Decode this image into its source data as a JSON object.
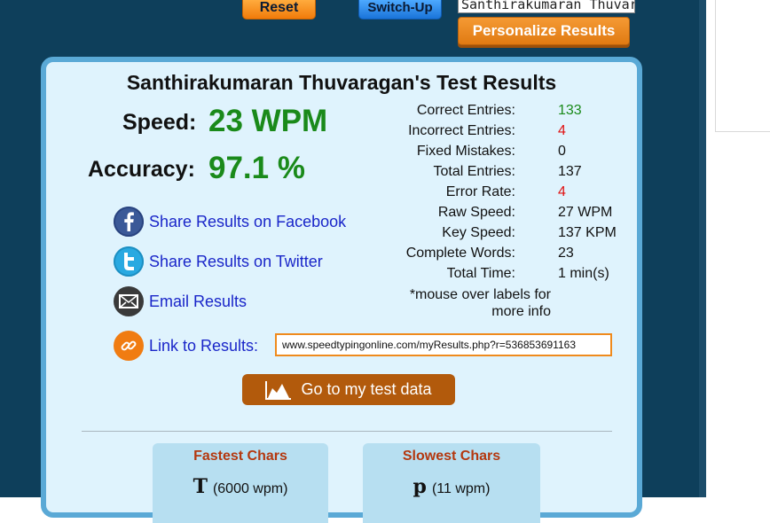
{
  "header": {
    "reset_label": "Reset",
    "switch_up_label": "Switch-Up",
    "name_input_value": "Santhirakumaran Thuvaragan",
    "personalize_label": "Personalize Results"
  },
  "results": {
    "title": "Santhirakumaran Thuvaragan's Test Results",
    "speed_label": "Speed:",
    "speed_value": "23 WPM",
    "accuracy_label": "Accuracy:",
    "accuracy_value": "97.1 %"
  },
  "share": {
    "facebook_label": "Share Results on Facebook",
    "twitter_label": "Share Results on Twitter",
    "email_label": "Email Results",
    "link_label": "Link to Results:",
    "link_value": "www.speedtypingonline.com/myResults.php?r=536853691163"
  },
  "stats": [
    {
      "label": "Correct Entries:",
      "value": "133",
      "color": "#1a8a1a"
    },
    {
      "label": "Incorrect Entries:",
      "value": "4",
      "color": "#e01010"
    },
    {
      "label": "Fixed Mistakes:",
      "value": "0",
      "color": "#111111"
    },
    {
      "label": "Total Entries:",
      "value": "137",
      "color": "#111111"
    },
    {
      "label": "Error Rate:",
      "value": "4",
      "color": "#e01010"
    },
    {
      "label": "Raw Speed:",
      "value": "27 WPM",
      "color": "#111111"
    },
    {
      "label": "Key Speed:",
      "value": "137 KPM",
      "color": "#111111"
    },
    {
      "label": "Complete Words:",
      "value": "23",
      "color": "#111111"
    },
    {
      "label": "Total Time:",
      "value": "1 min(s)",
      "color": "#111111"
    }
  ],
  "note": {
    "line1": "*mouse over labels for",
    "line2": "more info"
  },
  "test_data_button_label": "Go to my test data",
  "fastest": {
    "title": "Fastest Chars",
    "char": "T",
    "speed": "(6000 wpm)"
  },
  "slowest": {
    "title": "Slowest Chars",
    "char": "p",
    "speed": "(11 wpm)"
  },
  "colors": {
    "background": "#0e3f5b",
    "panel": "#dff3fd",
    "panel_border": "#5aa9d6",
    "value_green": "#1a8a1a",
    "error_red": "#e01010",
    "link_blue": "#1a26c9",
    "orange": "#ef8a1d"
  },
  "icons": [
    "facebook-icon",
    "twitter-icon",
    "email-icon",
    "link-icon",
    "chart-icon"
  ]
}
